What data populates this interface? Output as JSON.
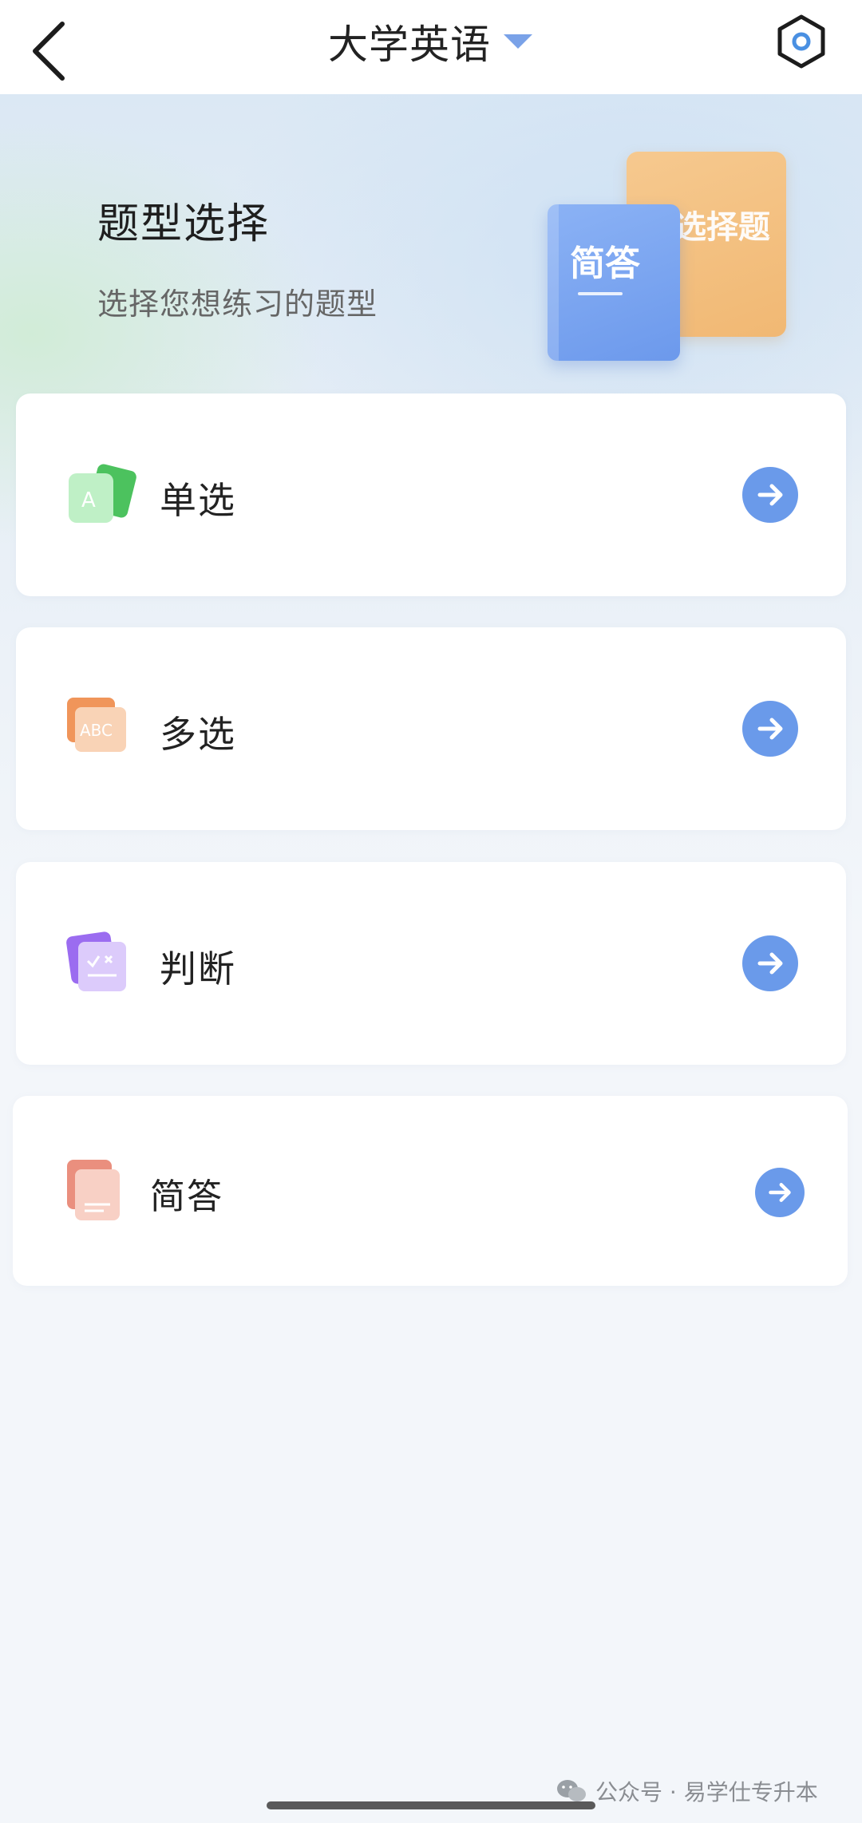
{
  "header": {
    "title": "大学英语"
  },
  "hero": {
    "title": "题型选择",
    "subtitle": "选择您想练习的题型",
    "book_back_label": "选择题",
    "book_front_label": "简答"
  },
  "question_types": [
    {
      "label": "单选",
      "icon": "single-choice-icon"
    },
    {
      "label": "多选",
      "icon": "multiple-choice-icon"
    },
    {
      "label": "判断",
      "icon": "true-false-icon"
    },
    {
      "label": "简答",
      "icon": "short-answer-icon"
    }
  ],
  "watermark": {
    "text": "公众号 · 易学仕专升本"
  },
  "colors": {
    "accent": "#6a9aea",
    "title_caret": "#7aa2e8",
    "settings_ring": "#4a90e2"
  }
}
